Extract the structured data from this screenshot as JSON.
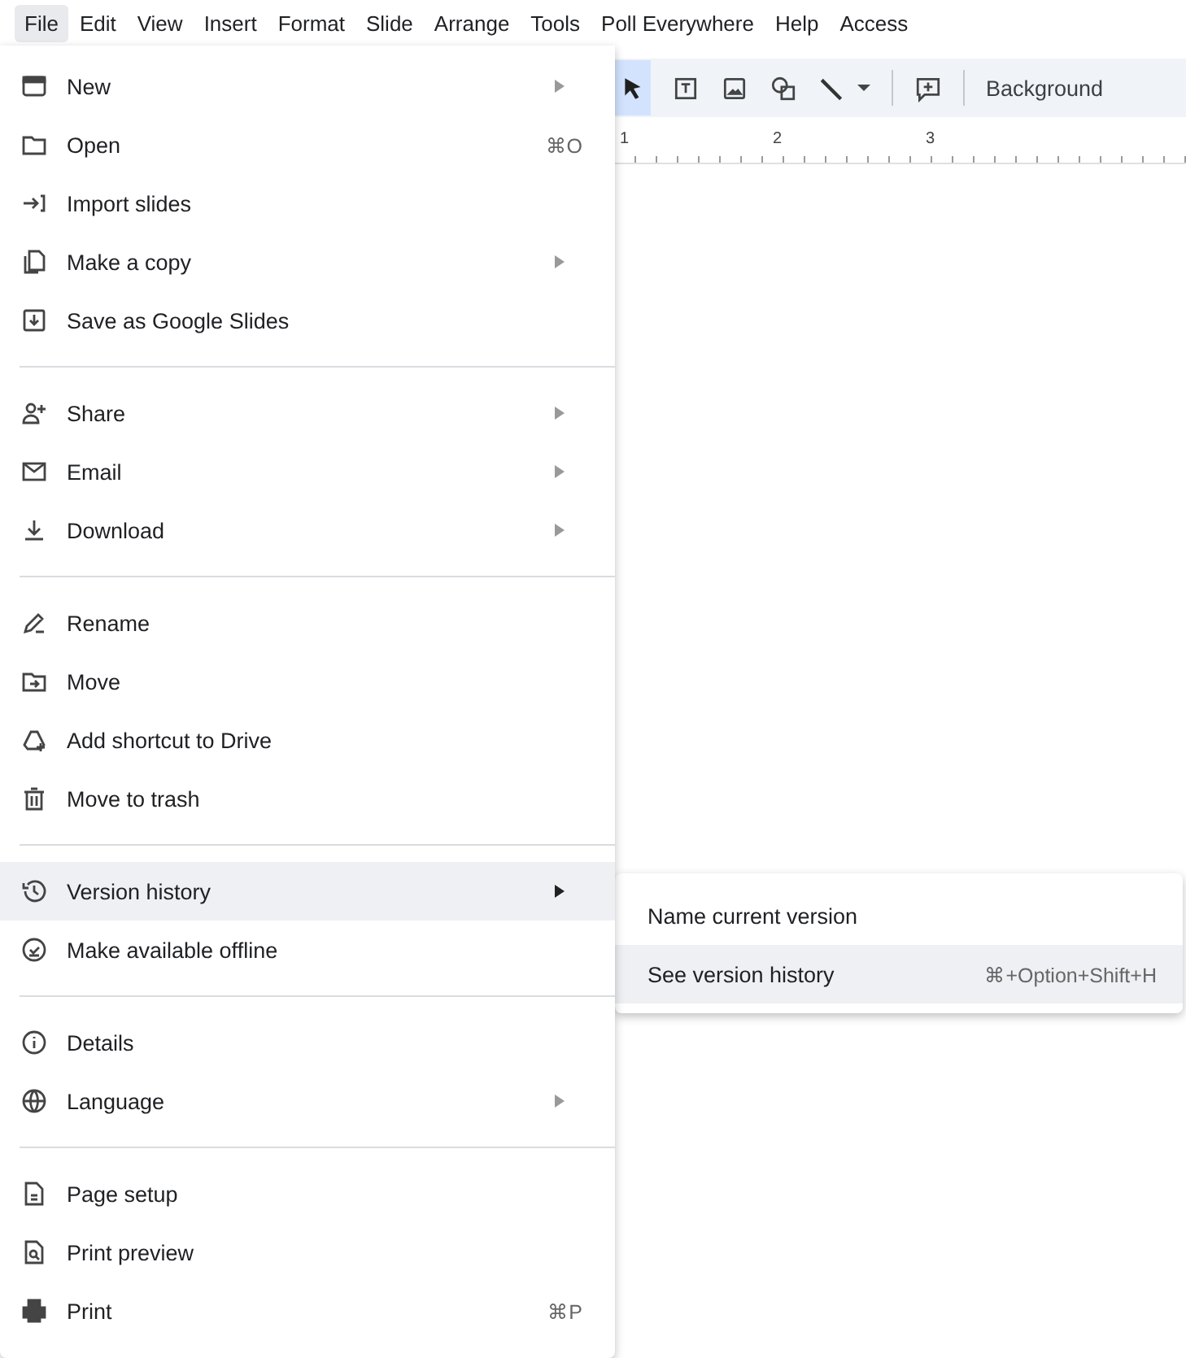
{
  "menubar": [
    {
      "label": "File",
      "selected": true
    },
    {
      "label": "Edit",
      "selected": false
    },
    {
      "label": "View",
      "selected": false
    },
    {
      "label": "Insert",
      "selected": false
    },
    {
      "label": "Format",
      "selected": false
    },
    {
      "label": "Slide",
      "selected": false
    },
    {
      "label": "Arrange",
      "selected": false
    },
    {
      "label": "Tools",
      "selected": false
    },
    {
      "label": "Poll Everywhere",
      "selected": false
    },
    {
      "label": "Help",
      "selected": false
    },
    {
      "label": "Access",
      "selected": false
    }
  ],
  "toolbar": {
    "background_button": "Background"
  },
  "ruler": [
    "1",
    "2",
    "3"
  ],
  "file_menu": [
    [
      {
        "label": "New",
        "submenu": true,
        "selected": false
      },
      {
        "label": "Open",
        "shortcut": "⌘O",
        "submenu": false,
        "selected": false
      },
      {
        "label": "Import slides",
        "submenu": false,
        "selected": false
      },
      {
        "label": "Make a copy",
        "submenu": true,
        "selected": false
      },
      {
        "label": "Save as Google Slides",
        "submenu": false,
        "selected": false
      }
    ],
    [
      {
        "label": "Share",
        "submenu": true,
        "selected": false
      },
      {
        "label": "Email",
        "submenu": true,
        "selected": false
      },
      {
        "label": "Download",
        "submenu": true,
        "selected": false
      }
    ],
    [
      {
        "label": "Rename",
        "submenu": false,
        "selected": false
      },
      {
        "label": "Move",
        "submenu": false,
        "selected": false
      },
      {
        "label": "Add shortcut to Drive",
        "submenu": false,
        "selected": false
      },
      {
        "label": "Move to trash",
        "submenu": false,
        "selected": false
      }
    ],
    [
      {
        "label": "Version history",
        "submenu": true,
        "selected": true
      },
      {
        "label": "Make available offline",
        "submenu": false,
        "selected": false
      }
    ],
    [
      {
        "label": "Details",
        "submenu": false,
        "selected": false
      },
      {
        "label": "Language",
        "submenu": true,
        "selected": false
      }
    ],
    [
      {
        "label": "Page setup",
        "submenu": false,
        "selected": false
      },
      {
        "label": "Print preview",
        "submenu": false,
        "selected": false
      },
      {
        "label": "Print",
        "shortcut": "⌘P",
        "submenu": false,
        "selected": false
      }
    ]
  ],
  "version_submenu": [
    {
      "label": "Name current version",
      "selected": false
    },
    {
      "label": "See version history",
      "shortcut": "⌘+Option+Shift+H",
      "selected": true
    }
  ]
}
